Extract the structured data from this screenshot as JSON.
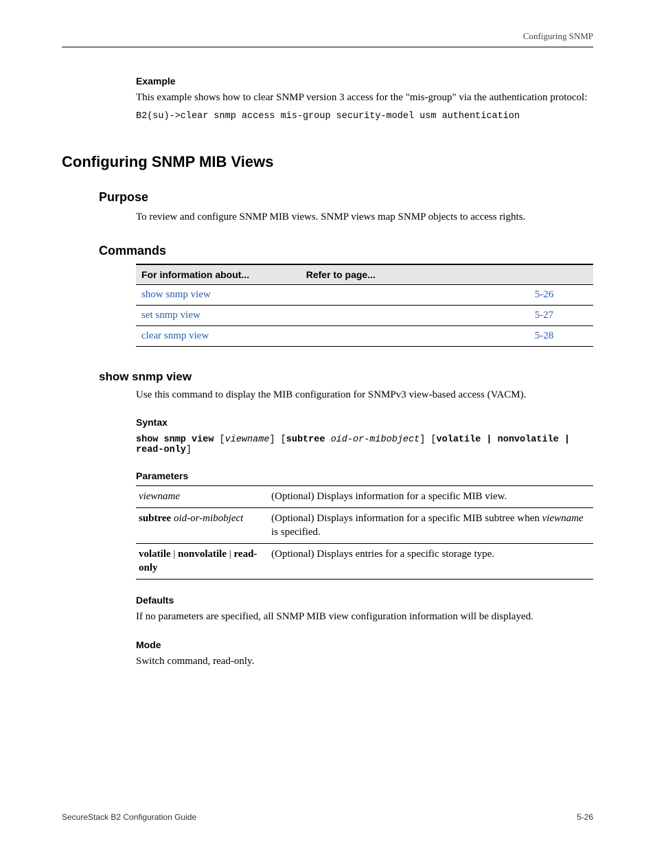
{
  "header": {
    "right": "Configuring SNMP"
  },
  "example": {
    "heading": "Example",
    "body_a": "This example shows how to clear SNMP version 3 access for the \"mis-group\" via the authentication protocol:",
    "cli": "B2(su)->clear snmp access mis-group security-model usm authentication"
  },
  "section_title": "Configuring SNMP MIB Views",
  "purpose": {
    "heading": "Purpose",
    "body": "To review and configure SNMP MIB views. SNMP views map SNMP objects to access rights."
  },
  "commands": {
    "heading": "Commands",
    "table": {
      "head": [
        "For information about...",
        "Refer to page...",
        ""
      ],
      "rows": [
        {
          "link": "show snmp view",
          "desc": "",
          "page": "5-26"
        },
        {
          "link": "set snmp view",
          "desc": "",
          "page": "5-27"
        },
        {
          "link": "clear snmp view",
          "desc": "",
          "page": "5-28"
        }
      ]
    }
  },
  "cmd": {
    "name": "show snmp view",
    "desc": "Use this command to display the MIB configuration for SNMPv3 view-based access (VACM).",
    "syntax_heading": "Syntax",
    "syntax_kw": "show snmp view",
    "syntax_opt_a": "viewname",
    "syntax_opt_b_kw": "subtree",
    "syntax_opt_b_arg": "oid-or-mibobject",
    "syntax_opt_c": "volatile | nonvolatile | read-only",
    "params_heading": "Parameters",
    "params": [
      {
        "term_italic": "viewname",
        "term_bold": "",
        "term_bold2": "",
        "desc_a": "(Optional) Displays information for a specific MIB view.",
        "desc_b": ""
      },
      {
        "term_bold": "subtree",
        "term_italic": "oid-or-mibobject",
        "term_bold2": "",
        "desc_a": "(Optional) Displays information for a specific MIB subtree when ",
        "desc_b_italic": "viewname",
        "desc_c": " is specified."
      },
      {
        "term_bold": "volatile",
        "term_sep1": " | ",
        "term_bold2": "nonvolatile",
        "term_sep2": " | ",
        "term_bold3": "read-only",
        "desc_a": "(Optional) Displays entries for a specific storage type."
      }
    ],
    "defaults_heading": "Defaults",
    "defaults_body": "If no parameters are specified, all SNMP MIB view configuration information will be displayed.",
    "mode_heading": "Mode",
    "mode_body": "Switch command, read-only."
  },
  "footer": {
    "left": "SecureStack B2 Configuration Guide",
    "right": "5-26"
  }
}
